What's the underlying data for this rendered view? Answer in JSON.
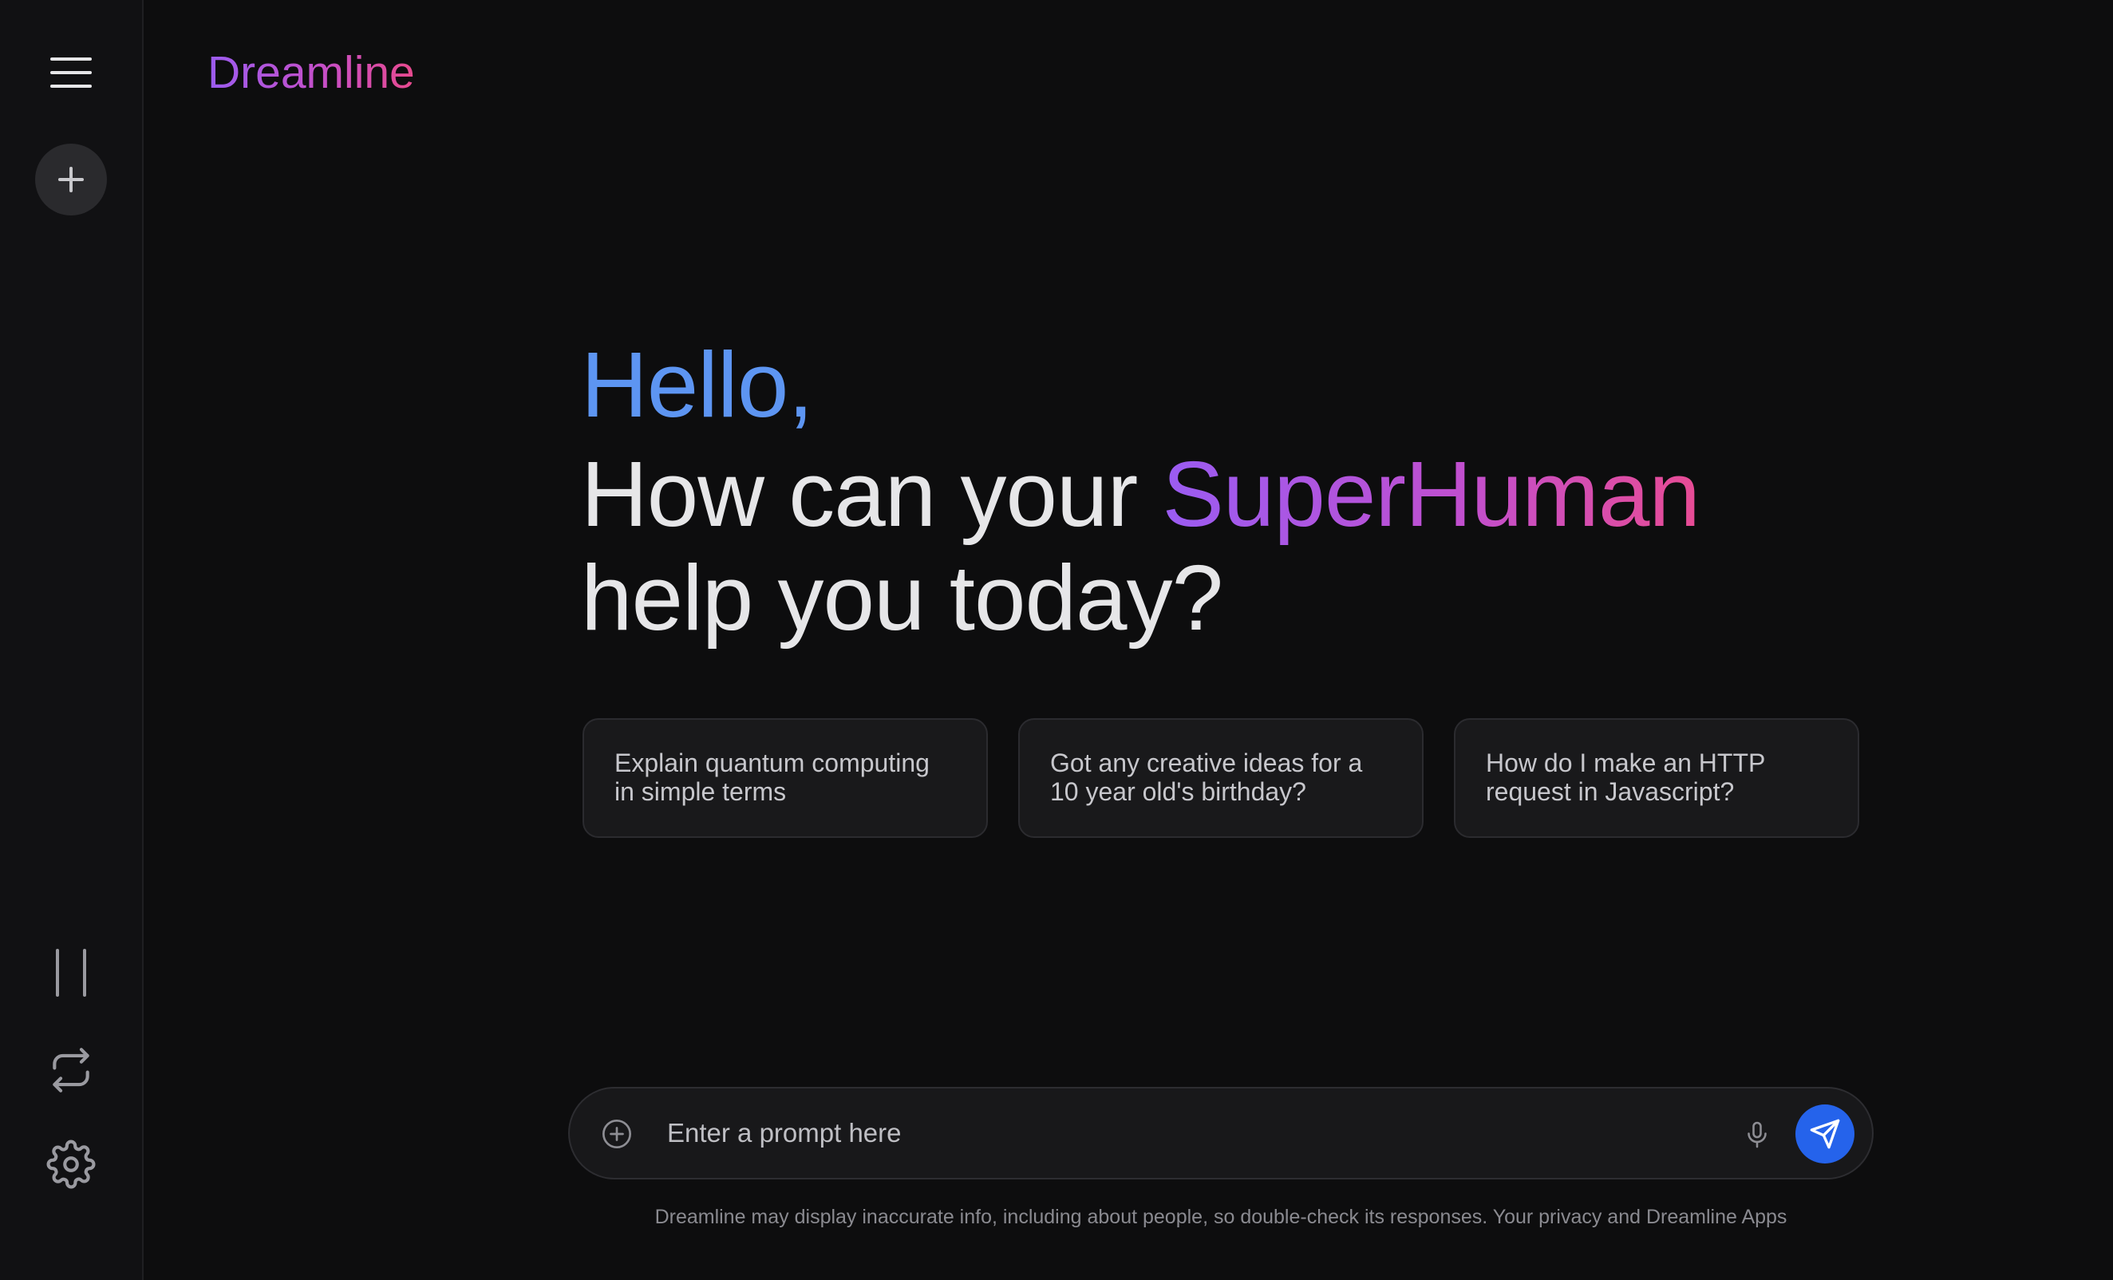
{
  "sidebar": {
    "menu_icon": "hamburger-menu-icon",
    "new_chat_icon": "plus-icon",
    "pause_icon": "pause-icon",
    "swap_icon": "repeat-icon",
    "settings_icon": "gear-icon"
  },
  "brand": {
    "name": "Dreamline"
  },
  "hero": {
    "greeting": "Hello,",
    "question_prefix": "How can your ",
    "question_accent": "SuperHuman",
    "question_suffix": "help you today?"
  },
  "suggestions": [
    {
      "text": "Explain quantum computing in simple terms"
    },
    {
      "text": "Got any creative ideas for a 10 year old's birthday?"
    },
    {
      "text": "How do I make an HTTP request in Javascript?"
    }
  ],
  "prompt": {
    "placeholder": "Enter a prompt here",
    "value": "",
    "attach_icon": "plus-circle-icon",
    "mic_icon": "microphone-icon",
    "send_icon": "send-icon"
  },
  "footer": {
    "disclaimer": "Dreamline may display inaccurate info, including about people, so double-check its responses. Your privacy and Dreamline Apps"
  },
  "colors": {
    "background": "#0d0d0e",
    "greeting_blue": "#5d95f2",
    "send_button_blue": "#2563eb",
    "gradient_start": "#9b5cf0",
    "gradient_end": "#e84a8e"
  }
}
